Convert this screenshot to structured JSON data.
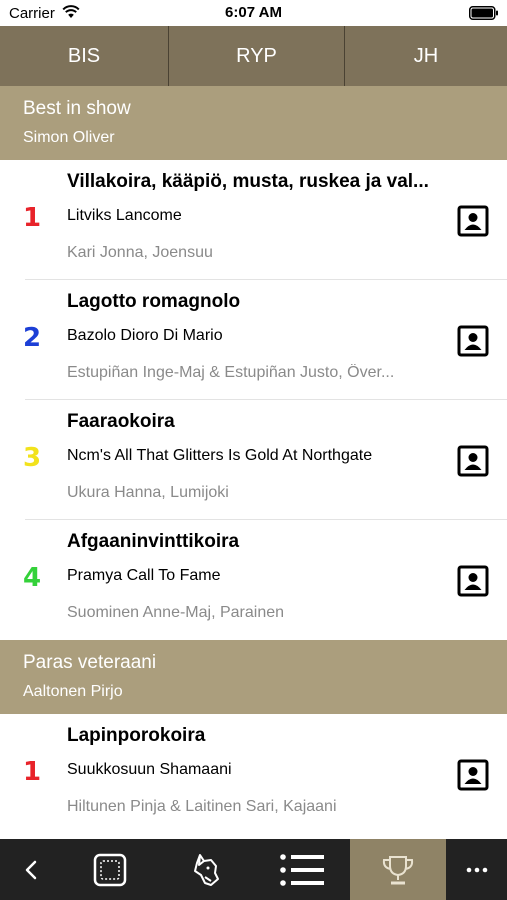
{
  "status_bar": {
    "carrier": "Carrier",
    "time": "6:07 AM"
  },
  "tabs": [
    {
      "label": "BIS",
      "active": true
    },
    {
      "label": "RYP",
      "active": false
    },
    {
      "label": "JH",
      "active": false
    }
  ],
  "sections": [
    {
      "title": "Best in show",
      "judge": "Simon Oliver",
      "entries": [
        {
          "rank": "1",
          "rank_color": "#e8232a",
          "breed": "Villakoira, kääpiö, musta, ruskea ja val...",
          "dog": "Litviks Lancome",
          "owner": "Kari Jonna, Joensuu"
        },
        {
          "rank": "2",
          "rank_color": "#1c3fd6",
          "breed": "Lagotto romagnolo",
          "dog": "Bazolo Dioro Di Mario",
          "owner": "Estupiñan Inge-Maj & Estupiñan Justo, Över..."
        },
        {
          "rank": "3",
          "rank_color": "#f2e21c",
          "breed": "Faaraokoira",
          "dog": "Ncm's All That Glitters Is Gold At Northgate",
          "owner": "Ukura Hanna, Lumijoki"
        },
        {
          "rank": "4",
          "rank_color": "#34d13a",
          "breed": "Afgaaninvinttikoira",
          "dog": "Pramya Call To Fame",
          "owner": "Suominen Anne-Maj, Parainen"
        }
      ]
    },
    {
      "title": "Paras veteraani",
      "judge": "Aaltonen Pirjo",
      "entries": [
        {
          "rank": "1",
          "rank_color": "#e8232a",
          "breed": "Lapinporokoira",
          "dog": "Suukkosuun Shamaani",
          "owner": "Hiltunen Pinja & Laitinen Sari, Kajaani"
        }
      ]
    }
  ],
  "bottom_bar": [
    {
      "icon": "back-icon",
      "active": false
    },
    {
      "icon": "square-icon",
      "active": false
    },
    {
      "icon": "dog-head-icon",
      "active": false
    },
    {
      "icon": "list-icon",
      "active": false
    },
    {
      "icon": "trophy-icon",
      "active": true
    },
    {
      "icon": "more-icon",
      "active": false
    }
  ],
  "colors": {
    "tab_bar": "#7e725a",
    "tab_active": "#b1a587",
    "section_header": "#ab9e7d",
    "bottom_bar": "#222222",
    "bottom_active": "#8f8366"
  }
}
